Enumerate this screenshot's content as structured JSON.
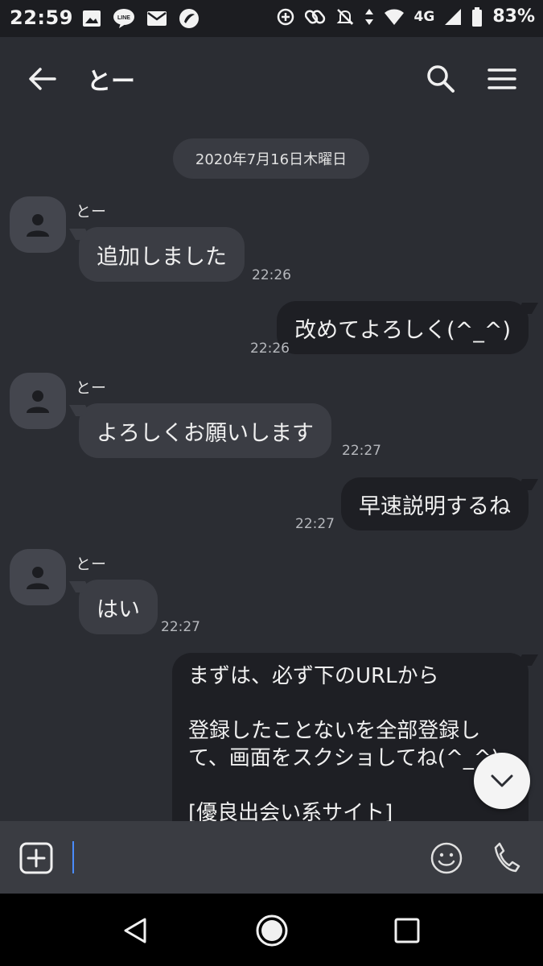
{
  "status_bar": {
    "time": "22:59",
    "network": "4G",
    "battery": "83%",
    "icons": [
      "image-icon",
      "line-icon",
      "mail-icon",
      "app-icon",
      "data-saver-icon",
      "link-icon",
      "mute-icon",
      "data-arrows-icon",
      "wifi-icon",
      "signal-icon",
      "battery-icon"
    ]
  },
  "header": {
    "title": "とー",
    "icons": [
      "back-arrow-icon",
      "search-icon",
      "menu-icon"
    ]
  },
  "chat": {
    "date_separator": "2020年7月16日木曜日",
    "messages": [
      {
        "direction": "in",
        "sender": "とー",
        "text": "追加しました",
        "time": "22:26"
      },
      {
        "direction": "out",
        "text": "改めてよろしく(^_^)",
        "time": "22:26"
      },
      {
        "direction": "in",
        "sender": "とー",
        "text": "よろしくお願いします",
        "time": "22:27"
      },
      {
        "direction": "out",
        "text": "早速説明するね",
        "time": "22:27"
      },
      {
        "direction": "in",
        "sender": "とー",
        "text": "はい",
        "time": "22:27"
      },
      {
        "direction": "out",
        "lines": [
          "まずは、必ず下のURLから",
          "",
          "登録したことないを全部登録し",
          "て、画面をスクショしてね(^_^)",
          "",
          "[優良出会い系サイト]"
        ]
      }
    ]
  },
  "input_bar": {
    "value": "",
    "placeholder": "",
    "icons": [
      "plus-icon",
      "emoji-icon",
      "phone-icon"
    ]
  },
  "nav_bar": {
    "icons": [
      "nav-back-icon",
      "nav-home-icon",
      "nav-recents-icon"
    ]
  },
  "colors": {
    "background": "#2b2d33",
    "incoming_bubble": "#3b3d44",
    "outgoing_bubble": "#1e1f24",
    "input_bar": "#3a3c42",
    "caret": "#4a8cff"
  }
}
